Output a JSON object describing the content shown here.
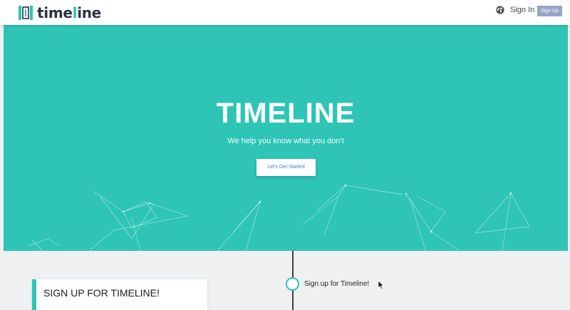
{
  "brand": {
    "name_start": "time",
    "name_pipe": "l",
    "name_end": "ine"
  },
  "nav": {
    "signin_label": "Sign In",
    "signup_label": "Sign Up",
    "language_icon": "globe-icon"
  },
  "hero": {
    "title": "TIMELINE",
    "subtitle": "We help you know what you don't",
    "cta_label": "Let's Get Started"
  },
  "timeline": {
    "step_label": "Sign up for Timeline!"
  },
  "card": {
    "title": "SIGN UP FOR TIMELINE!"
  },
  "colors": {
    "accent": "#2ec4b6",
    "nav_button": "#9aa5c6",
    "background": "#eef0f2"
  }
}
